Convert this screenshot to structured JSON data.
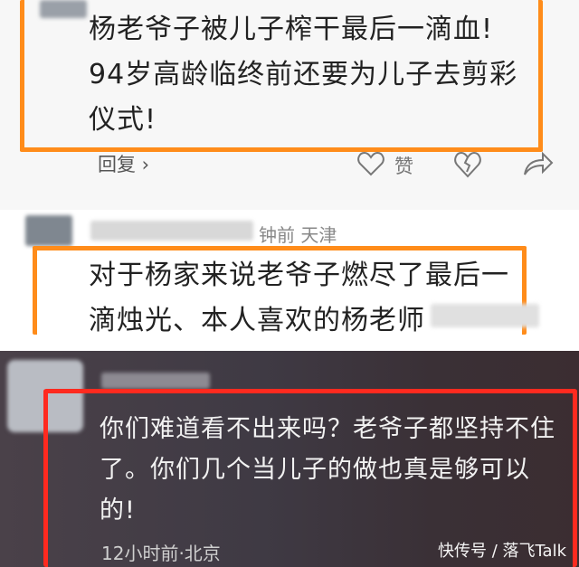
{
  "top_comment": {
    "lines": [
      "杨老爷子被儿子榨干最后一滴血!",
      "94岁高龄临终前还要为儿子去剪彩",
      "仪式!"
    ],
    "reply_label": "回复 ›",
    "like_label": "赞"
  },
  "mid_comment": {
    "meta_suffix": "钟前  天津",
    "lines": [
      "对于杨家来说老爷子燃尽了最后一",
      "滴烛光、本人喜欢的杨老师"
    ]
  },
  "bottom_comment": {
    "lines": [
      "你们难道看不出来吗？老爷子都坚持不住",
      "了。你们几个当儿子的做也真是够可以",
      "的!"
    ],
    "time_location": "12小时前·北京"
  },
  "watermark": "快传号 / 落飞Talk",
  "colors": {
    "highlight_orange": "#ff8c1a",
    "highlight_red": "#ff2a1f"
  },
  "icons": [
    "heart-icon",
    "dislike-icon",
    "share-icon",
    "avatar"
  ]
}
